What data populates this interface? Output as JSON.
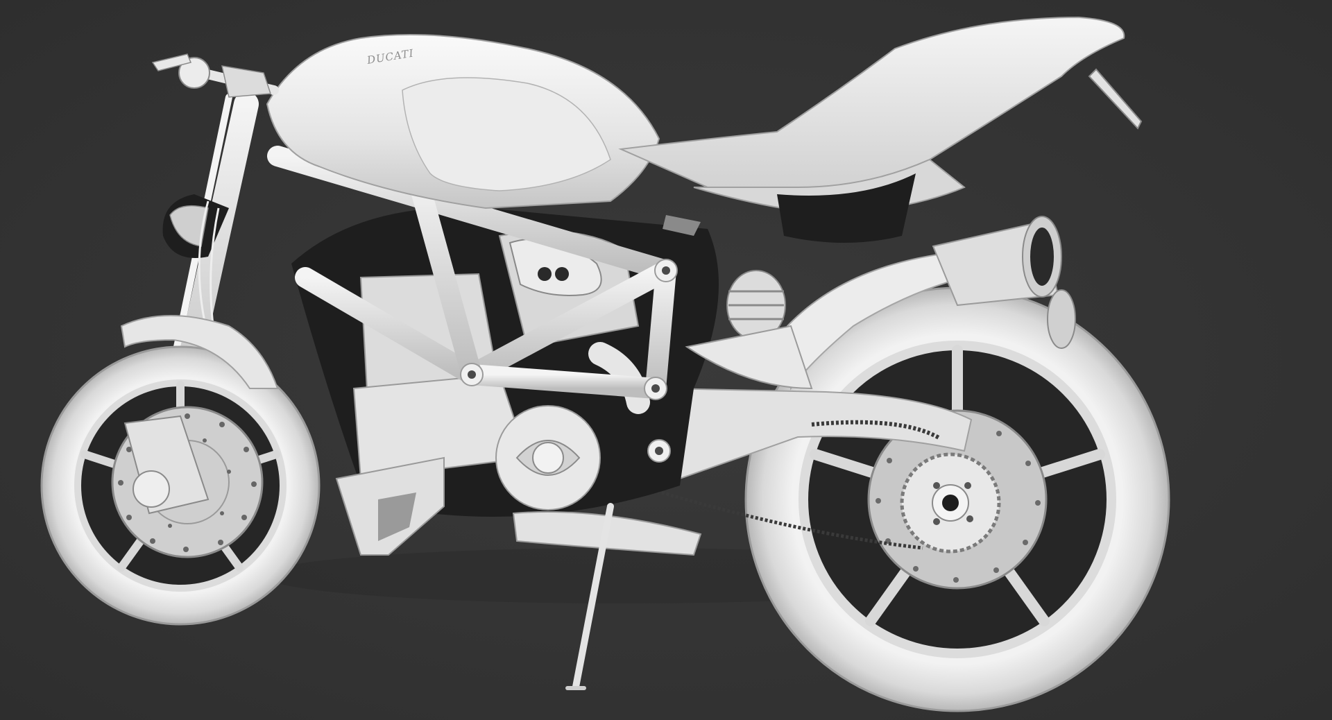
{
  "scene": {
    "subject": "motorcycle",
    "shading": "clay",
    "background_color": "#333333",
    "model_color": "#e6e6e6",
    "shadow_color": "#1a1a1a"
  },
  "logo": {
    "text": "DUCATI"
  }
}
